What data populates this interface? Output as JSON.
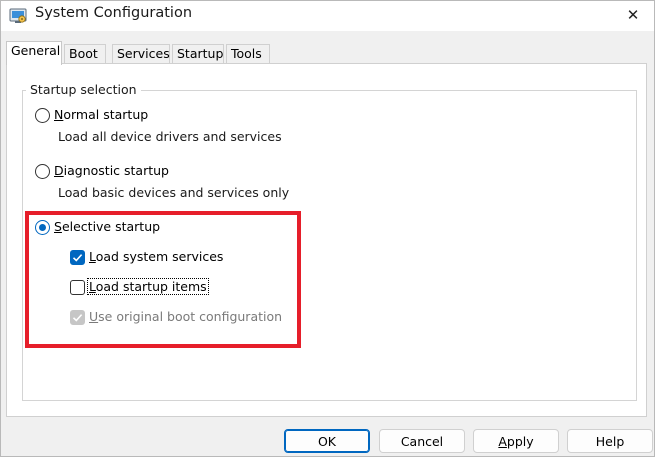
{
  "window": {
    "title": "System Configuration",
    "icon": "msconfig-icon",
    "close_glyph": "✕"
  },
  "tabs": [
    {
      "label": "General",
      "active": true
    },
    {
      "label": "Boot",
      "active": false
    },
    {
      "label": "Services",
      "active": false
    },
    {
      "label": "Startup",
      "active": false
    },
    {
      "label": "Tools",
      "active": false
    }
  ],
  "startup_selection": {
    "group_label": "Startup selection",
    "normal": {
      "label_accel": "N",
      "label_rest": "ormal startup",
      "description": "Load all device drivers and services",
      "selected": false
    },
    "diagnostic": {
      "label_accel": "D",
      "label_rest": "iagnostic startup",
      "description": "Load basic devices and services only",
      "selected": false
    },
    "selective": {
      "label_accel": "S",
      "label_rest": "elective startup",
      "selected": true,
      "options": {
        "system_services": {
          "label_accel": "L",
          "label_rest": "oad system services",
          "checked": true,
          "enabled": true
        },
        "startup_items": {
          "label_accel": "L",
          "label_rest": "oad startup items",
          "checked": false,
          "enabled": true
        },
        "original_boot": {
          "label_accel": "U",
          "label_rest": "se original boot configuration",
          "checked": true,
          "enabled": false
        }
      }
    }
  },
  "buttons": {
    "ok": "OK",
    "cancel": "Cancel",
    "apply_accel": "A",
    "apply_rest": "pply",
    "help": "Help"
  },
  "colors": {
    "accent": "#0067c0",
    "highlight_box": "#e61e2a"
  }
}
